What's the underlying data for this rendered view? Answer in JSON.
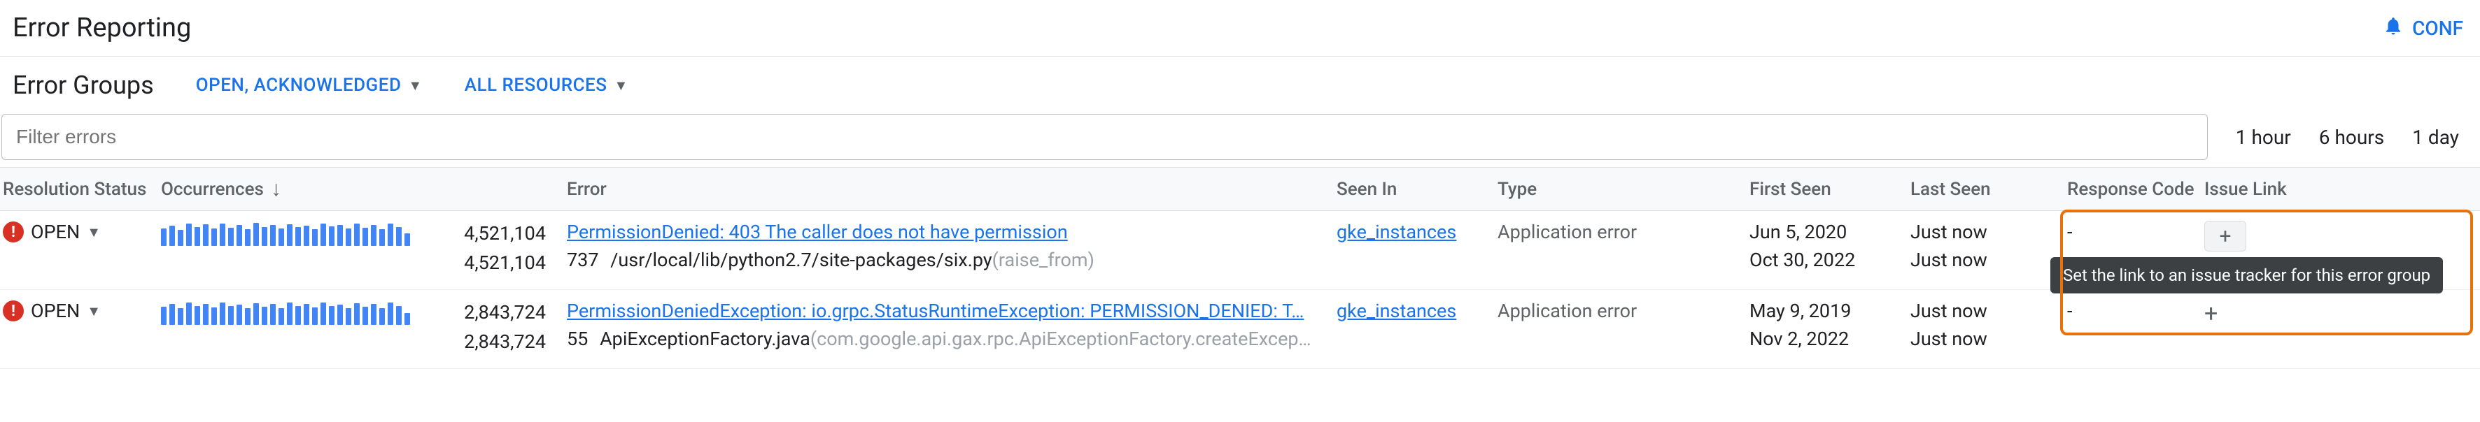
{
  "header": {
    "title": "Error Reporting",
    "conf_label": "CONF"
  },
  "subheader": {
    "title": "Error Groups",
    "filter_status": "OPEN, ACKNOWLEDGED",
    "filter_resources": "ALL RESOURCES"
  },
  "filter": {
    "placeholder": "Filter errors"
  },
  "time_options": [
    "1 hour",
    "6 hours",
    "1 day"
  ],
  "columns": {
    "status": "Resolution Status",
    "occurrences": "Occurrences",
    "error": "Error",
    "seen_in": "Seen In",
    "type": "Type",
    "first_seen": "First Seen",
    "last_seen": "Last Seen",
    "response_code": "Response Code",
    "issue_link": "Issue Link"
  },
  "tooltip": "Set the link to an issue tracker for this error group",
  "rows": [
    {
      "status": "OPEN",
      "count_top": "4,521,104",
      "count_bottom": "4,521,104",
      "error_title": "PermissionDenied: 403 The caller does not have permission",
      "error_lineno": "737",
      "error_path": "/usr/local/lib/python2.7/site-packages/six.py",
      "error_func": "(raise_from)",
      "seen_in": "gke_instances",
      "type": "Application error",
      "first_seen_top": "Jun 5, 2020",
      "first_seen_bottom": "Oct 30, 2022",
      "last_seen_top": "Just now",
      "last_seen_bottom": "Just now",
      "response_code": "-"
    },
    {
      "status": "OPEN",
      "count_top": "2,843,724",
      "count_bottom": "2,843,724",
      "error_title": "PermissionDeniedException: io.grpc.StatusRuntimeException: PERMISSION_DENIED: T…",
      "error_lineno": "55",
      "error_path": "ApiExceptionFactory.java",
      "error_func": "(com.google.api.gax.rpc.ApiExceptionFactory.createExcep…",
      "seen_in": "gke_instances",
      "type": "Application error",
      "first_seen_top": "May 9, 2019",
      "first_seen_bottom": "Nov 2, 2022",
      "last_seen_top": "Just now",
      "last_seen_bottom": "Just now",
      "response_code": "-"
    }
  ]
}
